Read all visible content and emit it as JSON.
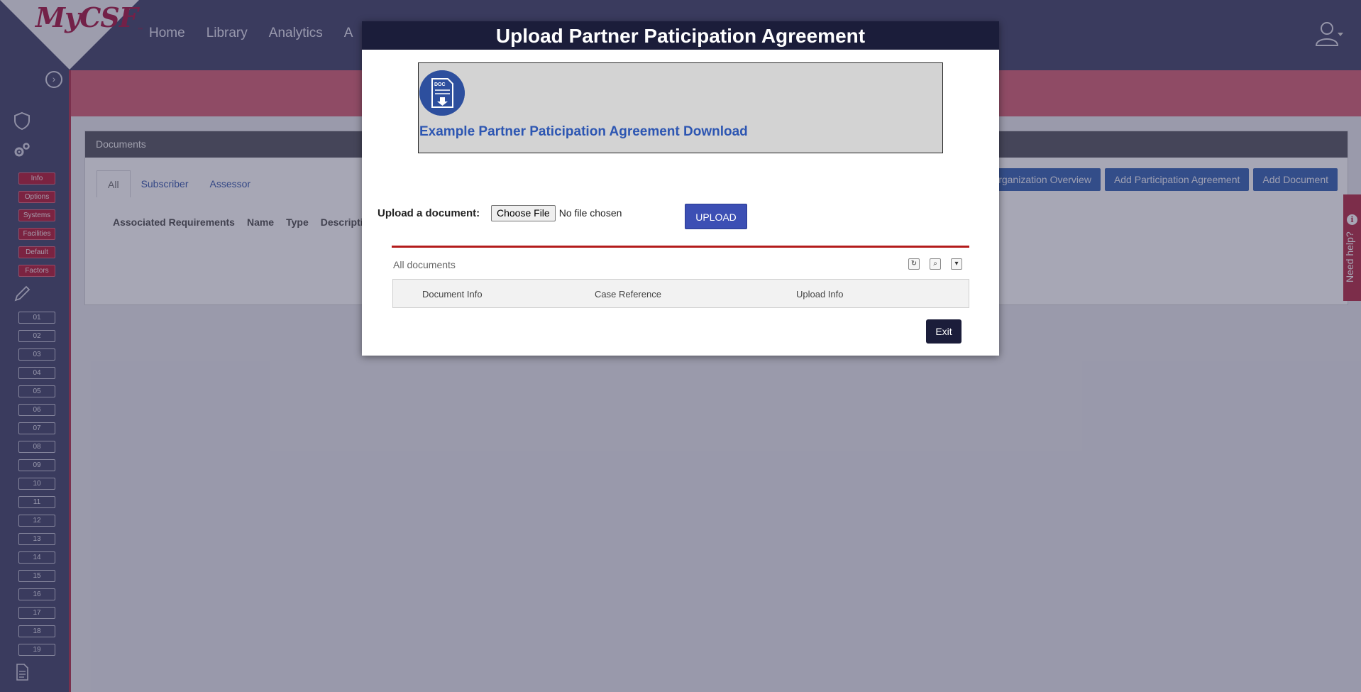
{
  "app": {
    "logo": "MyCSF",
    "logo_tm": "™"
  },
  "nav": {
    "items": [
      "Home",
      "Library",
      "Analytics",
      "A"
    ]
  },
  "sidebar": {
    "red_buttons": [
      "Info",
      "Options",
      "Systems",
      "Facilities",
      "Default",
      "Factors"
    ],
    "numbers": [
      "01",
      "02",
      "03",
      "04",
      "05",
      "06",
      "07",
      "08",
      "09",
      "10",
      "11",
      "12",
      "13",
      "14",
      "15",
      "16",
      "17",
      "18",
      "19"
    ]
  },
  "documents_panel": {
    "title": "Documents",
    "tabs": [
      "All",
      "Subscriber",
      "Assessor"
    ],
    "columns": [
      "Associated Requirements",
      "Name",
      "Type",
      "Descriptio"
    ],
    "actions": [
      "Organization Overview",
      "Add Participation Agreement",
      "Add Document"
    ]
  },
  "help": {
    "label": "Need help?",
    "icon": "i"
  },
  "modal": {
    "title": "Upload Partner Paticipation Agreement",
    "doc_icon_label": "DOC",
    "download_link": "Example Partner Paticipation Agreement Download",
    "upload_label": "Upload a document:",
    "choose_file": "Choose File",
    "file_status": "No file chosen",
    "upload_button": "UPLOAD",
    "grid_title": "All documents",
    "grid_columns": [
      "Document Info",
      "Case Reference",
      "Upload Info"
    ],
    "exit_button": "Exit"
  }
}
